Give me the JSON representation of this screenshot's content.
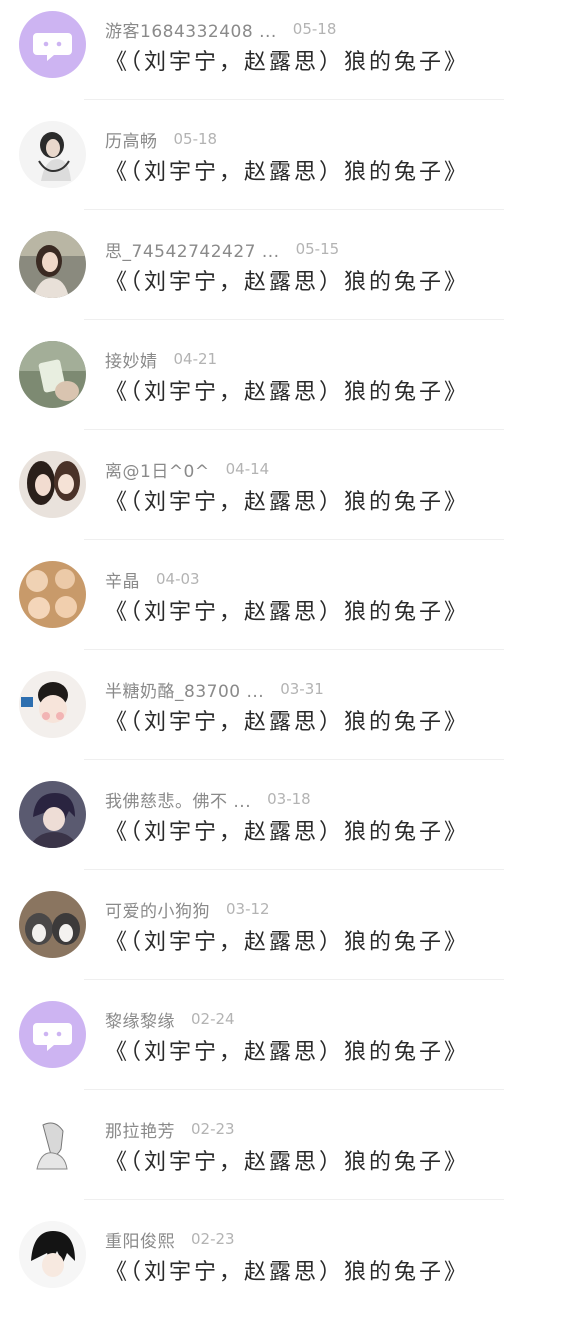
{
  "comments": [
    {
      "username": "游客1684332408 ...",
      "date": "05-18",
      "message": "《（刘宇宁，赵露思）狼的兔子》",
      "avatar": "default-chat-icon"
    },
    {
      "username": "历高畅",
      "date": "05-18",
      "message": "《（刘宇宁，赵露思）狼的兔子》",
      "avatar": "photo"
    },
    {
      "username": "思_74542742427 ...",
      "date": "05-15",
      "message": "《（刘宇宁，赵露思）狼的兔子》",
      "avatar": "photo"
    },
    {
      "username": "接妙婧",
      "date": "04-21",
      "message": "《（刘宇宁，赵露思）狼的兔子》",
      "avatar": "photo"
    },
    {
      "username": "离@1日^0^",
      "date": "04-14",
      "message": "《（刘宇宁，赵露思）狼的兔子》",
      "avatar": "photo"
    },
    {
      "username": "辛晶",
      "date": "04-03",
      "message": "《（刘宇宁，赵露思）狼的兔子》",
      "avatar": "photo"
    },
    {
      "username": "半糖奶酪_83700 ...",
      "date": "03-31",
      "message": "《（刘宇宁，赵露思）狼的兔子》",
      "avatar": "photo"
    },
    {
      "username": "我佛慈悲。佛不 ...",
      "date": "03-18",
      "message": "《（刘宇宁，赵露思）狼的兔子》",
      "avatar": "photo"
    },
    {
      "username": "可爱的小狗狗",
      "date": "03-12",
      "message": "《（刘宇宁，赵露思）狼的兔子》",
      "avatar": "photo"
    },
    {
      "username": "黎缘黎缘",
      "date": "02-24",
      "message": "《（刘宇宁，赵露思）狼的兔子》",
      "avatar": "default-chat-icon"
    },
    {
      "username": "那拉艳芳",
      "date": "02-23",
      "message": "《（刘宇宁，赵露思）狼的兔子》",
      "avatar": "photo"
    },
    {
      "username": "重阳俊熙",
      "date": "02-23",
      "message": "《（刘宇宁，赵露思）狼的兔子》",
      "avatar": "photo"
    }
  ],
  "colors": {
    "default_avatar_bg": "#cdb4f2",
    "username": "#8a8a8a",
    "date": "#b3b3b3",
    "message": "#2a2a2a",
    "divider": "#efefef"
  }
}
